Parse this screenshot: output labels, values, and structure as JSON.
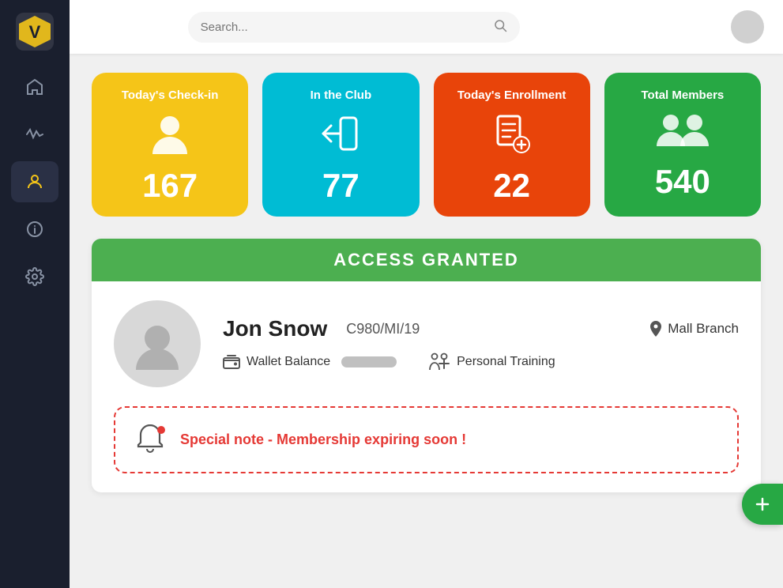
{
  "sidebar": {
    "logo_alt": "Vcheck Logo",
    "items": [
      {
        "id": "home",
        "label": "Home",
        "icon": "🏠",
        "active": false
      },
      {
        "id": "activity",
        "label": "Activity",
        "icon": "〜",
        "active": false
      },
      {
        "id": "person",
        "label": "Members",
        "icon": "👤",
        "active": true
      },
      {
        "id": "info",
        "label": "Info",
        "icon": "ℹ",
        "active": false
      },
      {
        "id": "settings",
        "label": "Settings",
        "icon": "⚙",
        "active": false
      }
    ]
  },
  "topbar": {
    "search_placeholder": "Search...",
    "avatar_alt": "User Avatar"
  },
  "stats": [
    {
      "id": "checkin",
      "label": "Today's Check-in",
      "number": "167",
      "color": "card-yellow"
    },
    {
      "id": "inclub",
      "label": "In the Club",
      "number": "77",
      "color": "card-cyan"
    },
    {
      "id": "enrollment",
      "label": "Today's Enrollment",
      "number": "22",
      "color": "card-orange"
    },
    {
      "id": "members",
      "label": "Total Members",
      "number": "540",
      "color": "card-green"
    }
  ],
  "access": {
    "header": "ACCESS GRANTED",
    "member": {
      "name": "Jon Snow",
      "id": "C980/MI/19",
      "branch": "Mall Branch",
      "wallet_label": "Wallet Balance",
      "pt_label": "Personal Training"
    }
  },
  "special_note": {
    "text": "Special note - Membership expiring soon !"
  }
}
